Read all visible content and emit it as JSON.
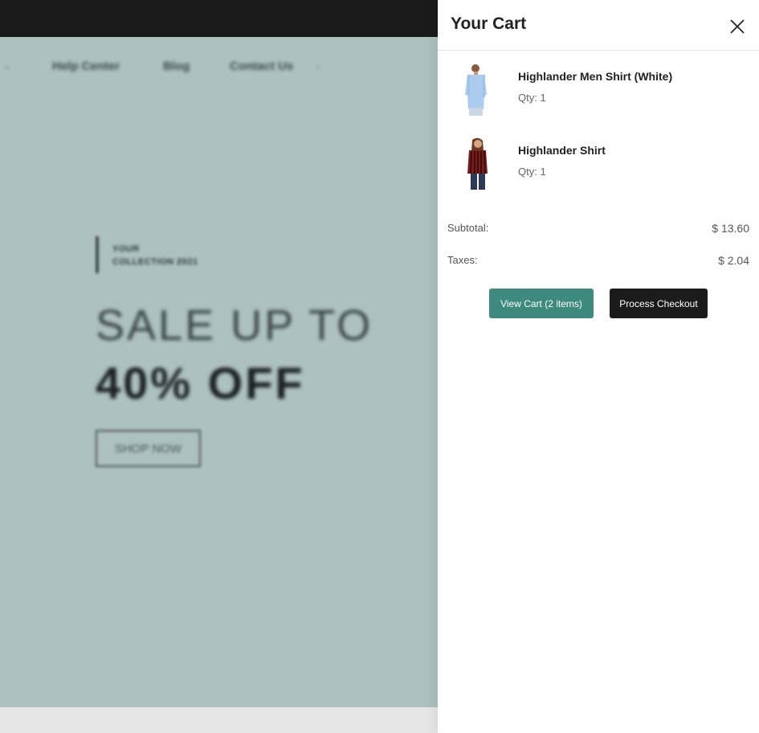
{
  "background_page": {
    "nav": {
      "items": [
        "Help Center",
        "Blog",
        "Contact Us"
      ],
      "separator": "-"
    },
    "hero": {
      "collection_line1": "YOUR",
      "collection_line2": "COLLECTION 2021",
      "headline_line1": "SALE UP TO",
      "headline_line2": "40% OFF",
      "shop_button": "SHOP NOW"
    }
  },
  "cart": {
    "title": "Your Cart",
    "items": [
      {
        "name": "Highlander Men Shirt (White)",
        "qty": "Qty: 1",
        "image": "man-in-light-blue-shirt"
      },
      {
        "name": "Highlander Shirt",
        "qty": "Qty: 1",
        "image": "woman-in-striped-red-shirt"
      }
    ],
    "subtotal_label": "Subtotal:",
    "subtotal_value": "$ 13.60",
    "taxes_label": "Taxes:",
    "taxes_value": "$ 2.04",
    "view_cart_label": "View Cart (2 items)",
    "checkout_label": "Process Checkout"
  },
  "colors": {
    "hero_background": "#adc2bf",
    "top_bar": "#1b1b1b",
    "view_cart_button": "#3f8a7e",
    "checkout_button": "#1c1c1c"
  }
}
